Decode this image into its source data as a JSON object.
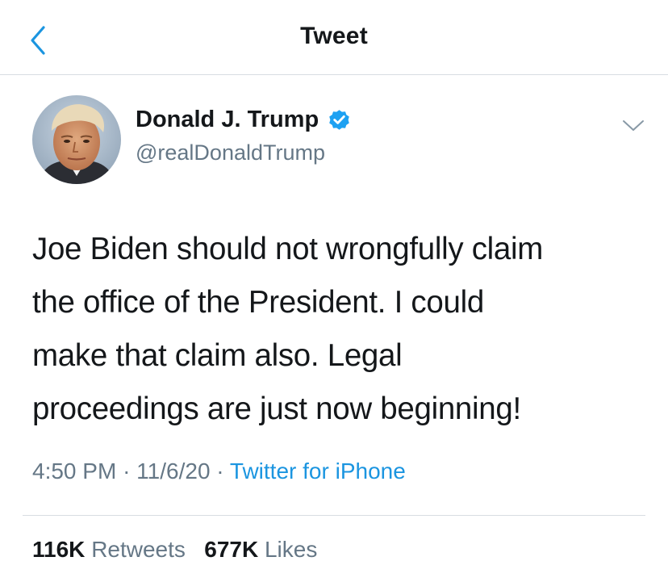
{
  "header": {
    "title": "Tweet",
    "back_icon": "chevron-left-icon",
    "accent_color": "#1b95e0"
  },
  "author": {
    "name": "Donald J. Trump",
    "handle": "@realDonaldTrump",
    "verified_icon": "verified-badge-icon",
    "menu_icon": "chevron-down-icon"
  },
  "tweet": {
    "text": "Joe Biden should not wrongfully claim\nthe office of the President. I could\nmake that claim also. Legal\nproceedings are just now beginning!",
    "time": "4:50 PM",
    "separator": "·",
    "date": "11/6/20",
    "source": "Twitter for iPhone"
  },
  "stats": {
    "retweets_count": "116K",
    "retweets_label": "Retweets",
    "likes_count": "677K",
    "likes_label": "Likes"
  },
  "colors": {
    "text_primary": "#14171a",
    "text_secondary": "#657786",
    "link": "#1b95e0",
    "divider": "#d8dde2",
    "verified": "#1da1f2"
  }
}
